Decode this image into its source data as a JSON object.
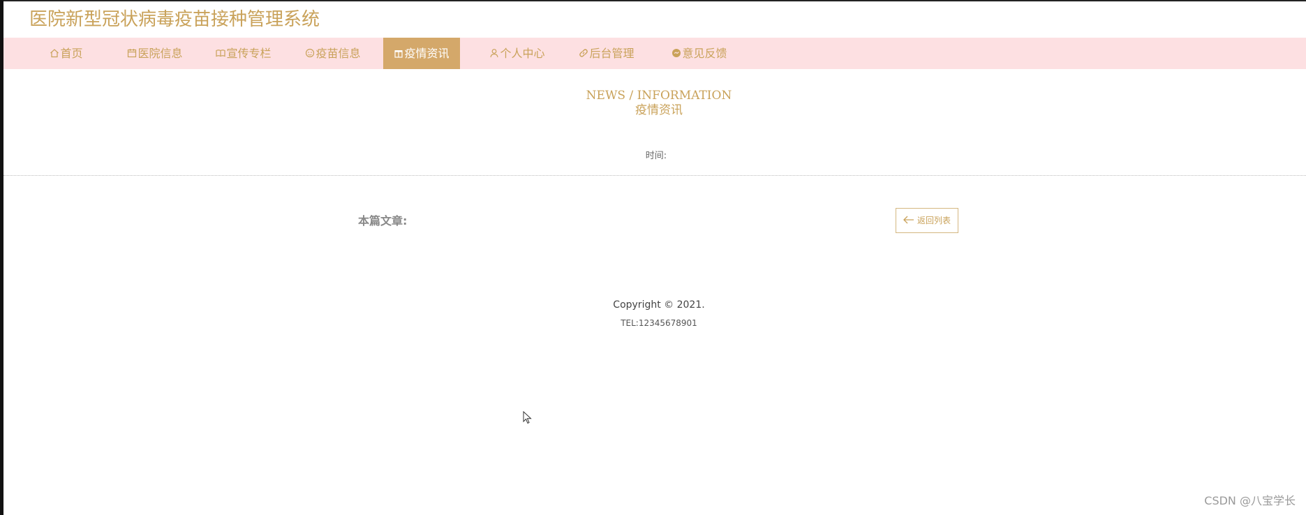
{
  "site": {
    "title": "医院新型冠状病毒疫苗接种管理系统"
  },
  "nav": {
    "items": [
      {
        "label": "首页",
        "icon": "home-icon",
        "active": false
      },
      {
        "label": "医院信息",
        "icon": "calendar-icon",
        "active": false
      },
      {
        "label": "宣传专栏",
        "icon": "book-icon",
        "active": false
      },
      {
        "label": "疫苗信息",
        "icon": "face-icon",
        "active": false
      },
      {
        "label": "疫情资讯",
        "icon": "gift-icon",
        "active": true
      },
      {
        "label": "个人中心",
        "icon": "user-icon",
        "active": false
      },
      {
        "label": "后台管理",
        "icon": "link-icon",
        "active": false
      },
      {
        "label": "意见反馈",
        "icon": "message-icon",
        "active": false
      }
    ],
    "colors": {
      "bar_bg": "#fde0e2",
      "text": "#c9a25a",
      "active_bg": "#d4a86a",
      "active_text": "#ffffff"
    }
  },
  "section": {
    "title_en": "NEWS / INFORMATION",
    "title_cn": "疫情资讯"
  },
  "article": {
    "time_label": "时间:",
    "label": "本篇文章:",
    "back_label": "返回列表"
  },
  "footer": {
    "copyright": "Copyright © 2021.",
    "tel": "TEL:12345678901"
  },
  "watermark": "CSDN @八宝学长"
}
